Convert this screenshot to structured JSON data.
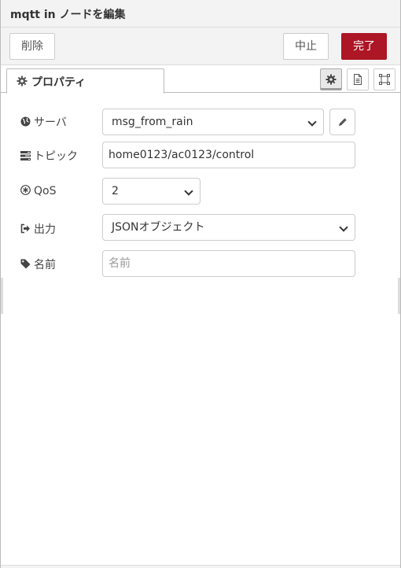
{
  "header": {
    "title": "mqtt in ノードを編集"
  },
  "toolbar": {
    "delete_label": "削除",
    "cancel_label": "中止",
    "done_label": "完了"
  },
  "tabs": [
    {
      "label": "プロパティ",
      "icon": "gear-icon"
    }
  ],
  "tab_icons": [
    "gear-icon",
    "document-icon",
    "frame-icon"
  ],
  "form": {
    "server": {
      "label": "サーバ",
      "icon": "globe-icon",
      "value": "msg_from_rain"
    },
    "topic": {
      "label": "トピック",
      "icon": "tasks-icon",
      "value": "home0123/ac0123/control"
    },
    "qos": {
      "label": "QoS",
      "icon": "asterisk-circle-icon",
      "value": "2"
    },
    "output": {
      "label": "出力",
      "icon": "sign-out-icon",
      "value": "JSONオブジェクト"
    },
    "name": {
      "label": "名前",
      "icon": "tag-icon",
      "value": "",
      "placeholder": "名前"
    }
  },
  "colors": {
    "accent": "#ad1625",
    "header_bg": "#f3f3f3",
    "border": "#cccccc"
  }
}
